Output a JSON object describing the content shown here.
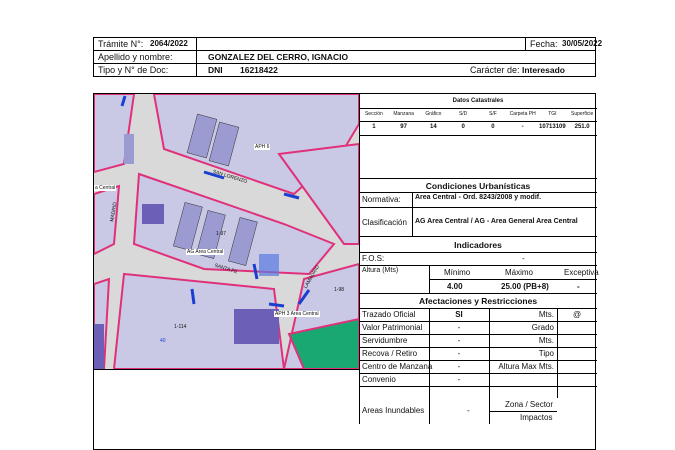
{
  "header": {
    "tramite_label": "Trámite N°:",
    "tramite_value": "2064/2022",
    "fecha_label": "Fecha:",
    "fecha_value": "30/05/2022",
    "apellido_label": "Apellido y nombre:",
    "apellido_value": "GONZALEZ DEL CERRO, IGNACIO",
    "tipo_doc_label": "Tipo y N° de Doc:",
    "tipo_doc_type": "DNI",
    "tipo_doc_number": "16218422",
    "caracter_label": "Carácter de:",
    "caracter_value": "Interesado"
  },
  "map": {
    "labels": {
      "aph6": "APH 6",
      "ag_area_central": "AG Area Central",
      "area_central": "a Central",
      "aph3": "APH 3 Area Central",
      "street_pizarro": "SAN LORENZO",
      "street_madero": "MADRID",
      "street_santafe": "SANTA FE",
      "street_lamadrid": "LAMADRID",
      "n_114": "1-114",
      "n_98": "1-98",
      "n_97": "1-97",
      "n_40": "40"
    },
    "colors": {
      "street": "#d9d9d9",
      "block_light": "#c9c9e6",
      "block_mid": "#9b9bd1",
      "block_dark": "#6b5fb8",
      "border_pink": "#e0307a",
      "border_blue": "#1a3fd0",
      "green": "#1aa872",
      "hatch": "#5a7ae0"
    }
  },
  "catastral": {
    "title": "Datos Catastrales",
    "headers": [
      "Sección",
      "Manzana",
      "Gráfico",
      "S/D",
      "S/F",
      "Carpeta PH",
      "TGI",
      "Superficie"
    ],
    "values": [
      "1",
      "97",
      "14",
      "0",
      "0",
      "-",
      "10713109",
      "251.0"
    ]
  },
  "condiciones": {
    "title": "Condiciones Urbanísticas",
    "normativa_label": "Normativa:",
    "normativa_value": "Area Central - Ord. 8243/2008 y modif.",
    "clasificacion_label": "Clasificación",
    "clasificacion_value": "AG Area Central / AG - Area General Area Central"
  },
  "indicadores": {
    "title": "Indicadores",
    "fos_label": "F.O.S:",
    "fos_value": "-",
    "altura_label": "Altura (Mts)",
    "minimo_label": "Mínimo",
    "maximo_label": "Máximo",
    "excepcion_label": "Exceptiva",
    "minimo_value": "4.00",
    "maximo_value": "25.00 (PB+8)",
    "excepcion_value": "-"
  },
  "afectaciones": {
    "title": "Afectaciones y Restricciones",
    "rows": [
      {
        "label": "Trazado Oficial",
        "value": "SI",
        "right_label": "Mts.",
        "right_value": "@"
      },
      {
        "label": "Valor Patrimonial",
        "value": "-",
        "right_label": "Grado",
        "right_value": ""
      },
      {
        "label": "Servidumbre",
        "value": "-",
        "right_label": "Mts.",
        "right_value": ""
      },
      {
        "label": "Recova / Retiro",
        "value": "-",
        "right_label": "Tipo",
        "right_value": ""
      },
      {
        "label": "Centro de Manzana",
        "value": "-",
        "right_label": "Altura Max Mts.",
        "right_value": ""
      },
      {
        "label": "Convenio",
        "value": "-",
        "right_label": "",
        "right_value": ""
      }
    ],
    "areas_label": "Areas Inundables",
    "areas_value": "-",
    "zona_label": "Zona / Sector",
    "impactos_label": "Impactos"
  }
}
